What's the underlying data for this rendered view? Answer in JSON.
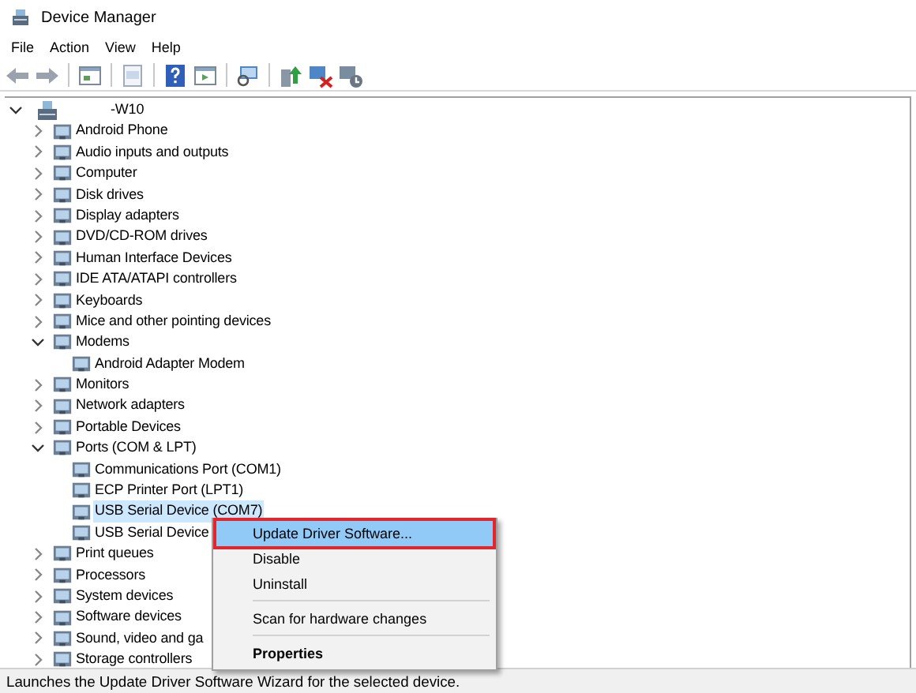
{
  "window": {
    "title": "Device Manager"
  },
  "menu_bar": [
    "File",
    "Action",
    "View",
    "Help"
  ],
  "tree": [
    {
      "label": "-W10",
      "expanded": true,
      "selected": false,
      "children": [
        {
          "label": "Android Phone",
          "expanded": false,
          "selected": false
        },
        {
          "label": "Audio inputs and outputs",
          "expanded": false,
          "selected": false
        },
        {
          "label": "Computer",
          "expanded": false,
          "selected": false
        },
        {
          "label": "Disk drives",
          "expanded": false,
          "selected": false
        },
        {
          "label": "Display adapters",
          "expanded": false,
          "selected": false
        },
        {
          "label": "DVD/CD-ROM drives",
          "expanded": false,
          "selected": false
        },
        {
          "label": "Human Interface Devices",
          "expanded": false,
          "selected": false
        },
        {
          "label": "IDE ATA/ATAPI controllers",
          "expanded": false,
          "selected": false
        },
        {
          "label": "Keyboards",
          "expanded": false,
          "selected": false
        },
        {
          "label": "Mice and other pointing devices",
          "expanded": false,
          "selected": false
        },
        {
          "label": "Modems",
          "expanded": true,
          "selected": false,
          "children": [
            {
              "label": "Android Adapter Modem",
              "selected": false
            }
          ]
        },
        {
          "label": "Monitors",
          "expanded": false,
          "selected": false
        },
        {
          "label": "Network adapters",
          "expanded": false,
          "selected": false
        },
        {
          "label": "Portable Devices",
          "expanded": false,
          "selected": false
        },
        {
          "label": "Ports (COM & LPT)",
          "expanded": true,
          "selected": false,
          "children": [
            {
              "label": "Communications Port (COM1)",
              "selected": false
            },
            {
              "label": "ECP Printer Port (LPT1)",
              "selected": false
            },
            {
              "label": "USB Serial Device (COM7)",
              "selected": true
            },
            {
              "label": "USB Serial Device",
              "selected": false
            }
          ]
        },
        {
          "label": "Print queues",
          "expanded": false,
          "selected": false
        },
        {
          "label": "Processors",
          "expanded": false,
          "selected": false
        },
        {
          "label": "System devices",
          "expanded": false,
          "selected": false
        },
        {
          "label": "Software devices",
          "expanded": false,
          "selected": false
        },
        {
          "label": "Sound, video and ga",
          "expanded": false,
          "selected": false
        },
        {
          "label": "Storage controllers",
          "expanded": false,
          "selected": false
        }
      ]
    }
  ],
  "context_menu": {
    "groups": [
      [
        {
          "label": "Update Driver Software...",
          "selected": true,
          "outlined": true,
          "default": false
        },
        {
          "label": "Disable",
          "selected": false,
          "outlined": false,
          "default": false
        },
        {
          "label": "Uninstall",
          "selected": false,
          "outlined": false,
          "default": false
        }
      ],
      [
        {
          "label": "Scan for hardware changes",
          "selected": false,
          "outlined": false,
          "default": false
        }
      ],
      [
        {
          "label": "Properties",
          "selected": false,
          "outlined": false,
          "default": true
        }
      ]
    ]
  },
  "status_bar": "Launches the Update Driver Software Wizard for the selected device."
}
